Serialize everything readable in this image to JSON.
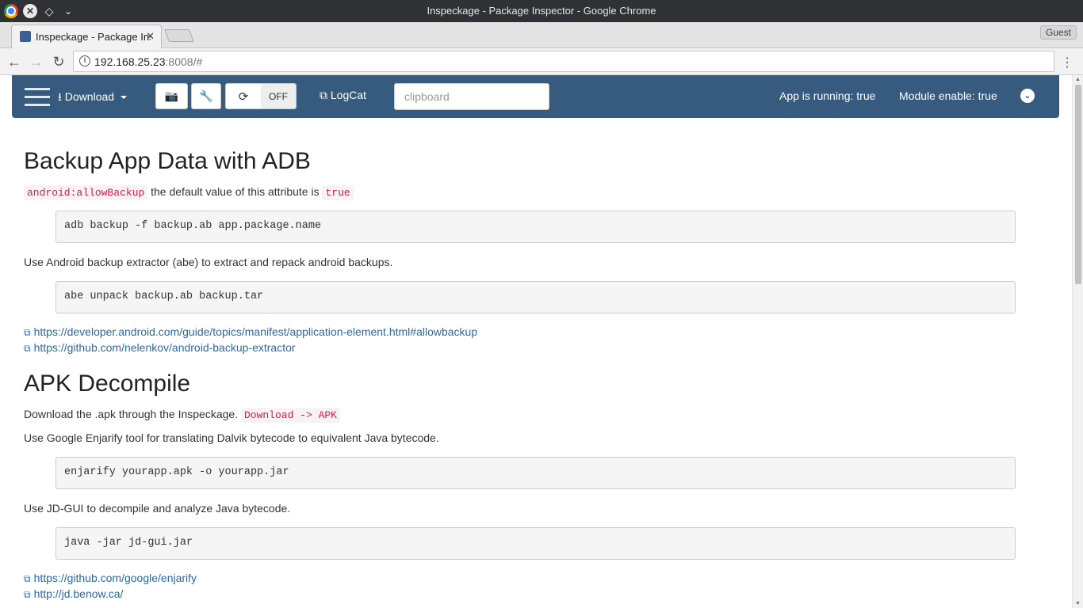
{
  "window": {
    "title": "Inspeckage - Package Inspector - Google Chrome"
  },
  "tabs": [
    {
      "label": "Inspeckage - Package Inspector"
    }
  ],
  "profile": {
    "label": "Guest"
  },
  "address": {
    "host": "192.168.25.23",
    "path": ":8008/#"
  },
  "navbar": {
    "download_label": "Download",
    "toggle_state": "OFF",
    "logcat_label": "LogCat",
    "clipboard_placeholder": "clipboard",
    "app_running": "App is running: true",
    "module_enable": "Module enable: true"
  },
  "content": {
    "section1": {
      "heading": "Backup App Data with ADB",
      "attr_code": "android:allowBackup",
      "attr_text": " the default value of this attribute is ",
      "attr_value": "true",
      "cmd1": "adb backup -f backup.ab app.package.name",
      "para": "Use Android backup extractor (abe) to extract and repack android backups.",
      "cmd2": "abe unpack backup.ab backup.tar",
      "links": [
        "https://developer.android.com/guide/topics/manifest/application-element.html#allowbackup",
        "https://github.com/nelenkov/android-backup-extractor"
      ]
    },
    "section2": {
      "heading": "APK Decompile",
      "download_text": "Download the .apk through the Inspeckage.",
      "download_code": "Download -> APK",
      "para1": "Use Google Enjarify tool for translating Dalvik bytecode to equivalent Java bytecode.",
      "cmd1": "enjarify yourapp.apk -o yourapp.jar",
      "para2": "Use JD-GUI to decompile and analyze Java bytecode.",
      "cmd2": "java -jar jd-gui.jar",
      "links": [
        "https://github.com/google/enjarify",
        "http://jd.benow.ca/"
      ]
    }
  },
  "colors": {
    "navbar": "#375a7f",
    "link": "#2a6aa0",
    "code": "#c7254e"
  },
  "icons": [
    "chrome-icon",
    "close-icon",
    "diamond-icon",
    "chevron-down-icon",
    "back-icon",
    "forward-icon",
    "reload-icon",
    "info-icon",
    "menu-icon",
    "download-icon",
    "camera-icon",
    "wrench-icon",
    "refresh-icon",
    "external-link-icon"
  ]
}
